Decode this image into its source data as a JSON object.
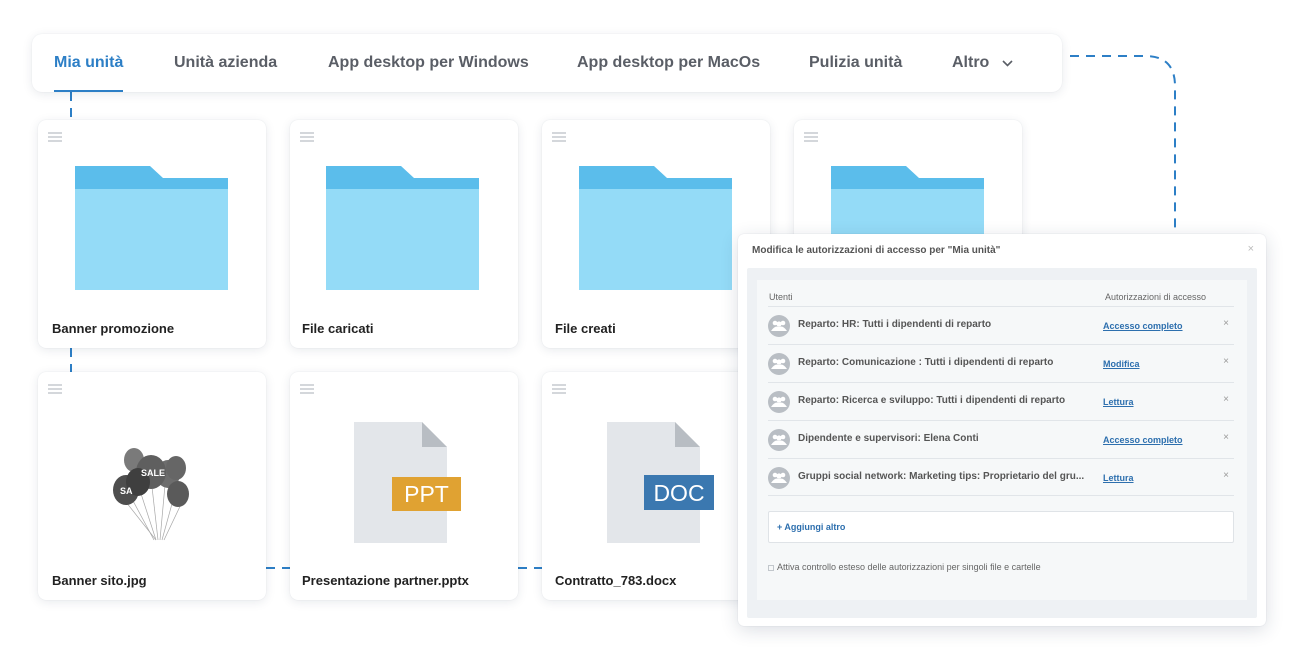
{
  "tabs": [
    {
      "label": "Mia unità",
      "active": true
    },
    {
      "label": "Unità azienda",
      "active": false
    },
    {
      "label": "App desktop per Windows",
      "active": false
    },
    {
      "label": "App desktop per MacOs",
      "active": false
    },
    {
      "label": "Pulizia unità",
      "active": false
    },
    {
      "label": "Altro",
      "active": false
    }
  ],
  "cards": [
    {
      "name": "Banner promozione",
      "type": "folder"
    },
    {
      "name": "File caricati",
      "type": "folder"
    },
    {
      "name": "File creati",
      "type": "folder"
    },
    {
      "name": "",
      "type": "folder"
    },
    {
      "name": "Banner sito.jpg",
      "type": "image"
    },
    {
      "name": "Presentazione partner.pptx",
      "type": "ppt"
    },
    {
      "name": "Contratto_783.docx",
      "type": "doc"
    }
  ],
  "badges": {
    "ppt": "PPT",
    "doc": "DOC"
  },
  "balloons": {
    "sale_text": "SALE",
    "sa_text": "SA"
  },
  "icons": {
    "menu": "menu-lines-icon",
    "folder": "folder-icon",
    "file": "file-icon",
    "chevron": "chevron-down-icon",
    "group": "group-icon",
    "close": "close-icon"
  },
  "colors": {
    "accent": "#2d7fc6",
    "folder_front": "#94dbf7",
    "folder_back": "#5bbdeb",
    "ppt_badge": "#e0a232",
    "doc_badge": "#3b78b0",
    "file_body": "#e3e6ea",
    "file_fold": "#b8bdc3"
  },
  "permissions_dialog": {
    "title": "Modifica le autorizzazioni di accesso per \"Mia unità\"",
    "close": "×",
    "col_users": "Utenti",
    "col_access": "Autorizzazioni di accesso",
    "rows": [
      {
        "user": "Reparto: HR: Tutti i dipendenti di reparto",
        "access": "Accesso completo",
        "remove": "×"
      },
      {
        "user": "Reparto: Comunicazione : Tutti i dipendenti di reparto",
        "access": "Modifica",
        "remove": "×"
      },
      {
        "user": "Reparto: Ricerca e sviluppo: Tutti i dipendenti di reparto",
        "access": "Lettura",
        "remove": "×"
      },
      {
        "user": "Dipendente e supervisori: Elena Conti",
        "access": "Accesso completo",
        "remove": "×"
      },
      {
        "user": "Gruppi social network: Marketing tips: Proprietario del gru...",
        "access": "Lettura",
        "remove": "×"
      }
    ],
    "add_more": "+ Aggiungi altro",
    "extended_control": "Attiva controllo esteso delle autorizzazioni per singoli file e cartelle",
    "extended_control_checked": false
  }
}
